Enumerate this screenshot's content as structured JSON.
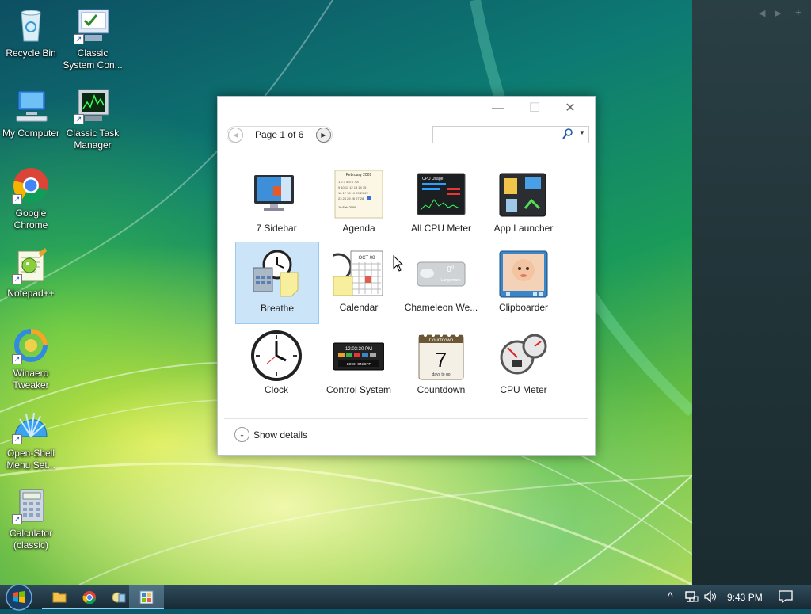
{
  "desktop": {
    "icons": [
      {
        "label": "Recycle Bin"
      },
      {
        "label": "Classic System Con..."
      },
      {
        "label": "My Computer"
      },
      {
        "label": "Classic Task Manager"
      },
      {
        "label": "Google Chrome"
      },
      {
        "label": "Notepad++"
      },
      {
        "label": "Winaero Tweaker"
      },
      {
        "label": "Open-Shell Menu Set..."
      },
      {
        "label": "Calculator (classic)"
      }
    ]
  },
  "gallery": {
    "page_label": "Page 1 of 6",
    "search": {
      "value": "",
      "placeholder": ""
    },
    "gadgets": [
      {
        "name": "7 Sidebar",
        "icon": "sidebar-monitor-icon"
      },
      {
        "name": "Agenda",
        "icon": "agenda-calendar-icon",
        "text_top": "February 2009",
        "text_bottom": "19 Feb 2009"
      },
      {
        "name": "All CPU Meter",
        "icon": "cpu-usage-icon",
        "text_top": "CPU Usage"
      },
      {
        "name": "App Launcher",
        "icon": "app-launcher-icon"
      },
      {
        "name": "Breathe",
        "icon": "breathe-clock-icon",
        "selected": true
      },
      {
        "name": "Calendar",
        "icon": "calendar-icon",
        "text_top": "OCT 08"
      },
      {
        "name": "Chameleon We...",
        "icon": "weather-icon",
        "text_top": "0°",
        "text_bottom": "Langemark"
      },
      {
        "name": "Clipboarder",
        "icon": "clipboarder-photo-icon"
      },
      {
        "name": "Clock",
        "icon": "analog-clock-icon"
      },
      {
        "name": "Control System",
        "icon": "control-system-icon",
        "text_top": "12:03:30 PM",
        "text_bottom": "LOCK ON/OFF"
      },
      {
        "name": "Countdown",
        "icon": "countdown-icon",
        "text_top": "Countdown",
        "value": "7",
        "text_bottom": "days to go"
      },
      {
        "name": "CPU Meter",
        "icon": "cpu-meter-gauge-icon"
      }
    ],
    "details_label": "Show details"
  },
  "taskbar": {
    "apps": [
      {
        "name": "file-explorer-icon"
      },
      {
        "name": "chrome-icon"
      },
      {
        "name": "gadgets-icon"
      },
      {
        "name": "gallery-icon"
      }
    ],
    "clock": "9:43 PM"
  },
  "colors": {
    "selection_bg": "#cce4f7",
    "selection_border": "#99c9ef",
    "side_panel": "#1f3236"
  }
}
